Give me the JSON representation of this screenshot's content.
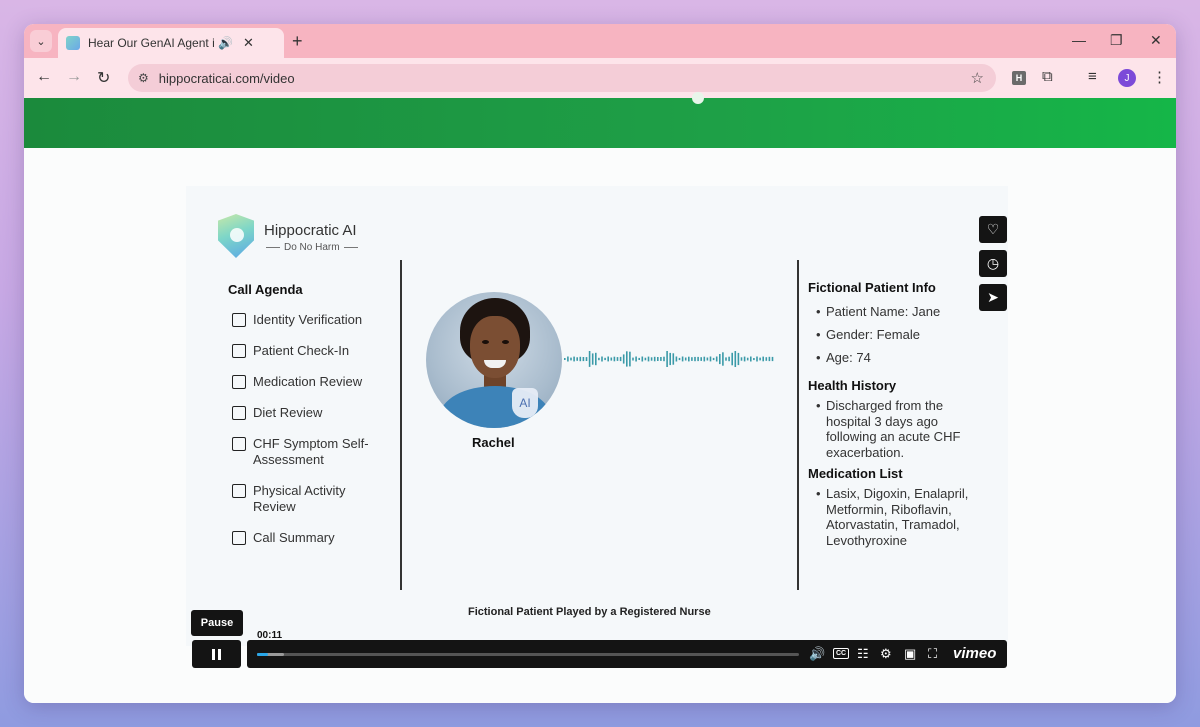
{
  "browser": {
    "tab_title": "Hear Our GenAI Agent in Action",
    "url": "hippocraticai.com/video",
    "profile_initial": "J",
    "extension_label": "H",
    "icons": {
      "tab_menu": "chevron-down-icon",
      "audio": "speaker-icon",
      "close": "close-icon",
      "new_tab": "plus-icon",
      "back": "arrow-left-icon",
      "forward": "arrow-right-icon",
      "reload": "reload-icon",
      "site_info": "tune-icon",
      "bookmark": "star-icon",
      "extensions": "puzzle-icon",
      "media": "playlist-icon",
      "menu": "kebab-icon",
      "minimize": "minimize-icon",
      "restore": "restore-icon",
      "window_close": "close-icon"
    },
    "glyphs": {
      "tab_menu": "⌄",
      "audio": "🔊",
      "close": "✕",
      "new_tab": "+",
      "back": "←",
      "forward": "→",
      "reload": "↻",
      "site_info": "⚙",
      "bookmark": "☆",
      "extensions": "⧉",
      "media": "≡",
      "menu": "⋮",
      "minimize": "—",
      "restore": "❐",
      "window_close": "✕"
    }
  },
  "video": {
    "brand": {
      "name": "Hippocratic AI",
      "tagline": "Do No Harm"
    },
    "agenda": {
      "title": "Call Agenda",
      "items": [
        "Identity Verification",
        "Patient Check-In",
        "Medication Review",
        "Diet Review",
        "CHF Symptom Self-Assessment",
        "Physical Activity Review",
        "Call Summary"
      ]
    },
    "agent": {
      "name": "Rachel",
      "badge": "AI"
    },
    "patient_info": {
      "title": "Fictional Patient Info",
      "items": [
        "Patient Name: Jane",
        "Gender: Female",
        "Age: 74"
      ]
    },
    "health_history": {
      "title": "Health History",
      "items": [
        "Discharged from the hospital 3 days ago following an acute CHF exacerbation."
      ]
    },
    "medication_list": {
      "title": "Medication List",
      "items": [
        "Lasix, Digoxin, Enalapril, Metformin, Riboflavin, Atorvastatin, Tramadol, Levothyroxine"
      ]
    },
    "caption": "Fictional Patient Played by a Registered Nurse"
  },
  "player": {
    "pause_tooltip": "Pause",
    "current_time": "00:11",
    "progress": 0.02,
    "buffered": 0.05,
    "brand": "vimeo",
    "cc_label": "CC",
    "accent_color": "#29a6e8",
    "icons": {
      "play_pause": "pause-icon",
      "volume": "volume-icon",
      "captions": "cc-icon",
      "transcript": "transcript-icon",
      "settings": "gear-icon",
      "pip": "picture-in-picture-icon",
      "fullscreen": "fullscreen-icon",
      "like": "heart-icon",
      "watch_later": "clock-icon",
      "share": "send-icon"
    },
    "glyphs": {
      "volume": "🔊",
      "transcript": "☷",
      "settings": "⚙",
      "pip": "▣",
      "fullscreen": "⛶",
      "like": "♡",
      "watch_later": "◷",
      "share": "➤"
    }
  },
  "colors": {
    "banner_green": "#1ea047",
    "tab_strip": "#f7b4c1",
    "waveform": "#3a9aa8"
  }
}
